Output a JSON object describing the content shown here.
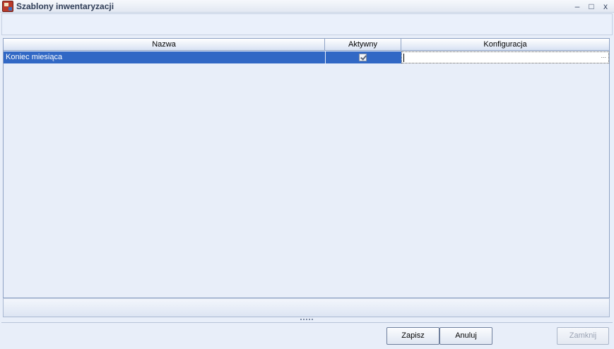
{
  "window": {
    "title": "Szablony inwentaryzacji",
    "minimize_glyph": "–",
    "maximize_glyph": "□",
    "close_glyph": "x"
  },
  "grid": {
    "columns": [
      "Nazwa",
      "Aktywny",
      "Konfiguracja"
    ],
    "rows": [
      {
        "name": "Koniec miesiąca",
        "active": true,
        "config": "",
        "config_button": "..."
      }
    ],
    "selection_color": "#3168c5"
  },
  "buttons": {
    "save": "Zapisz",
    "cancel": "Anuluj",
    "close": "Zamknij"
  },
  "icons": {
    "app": "app-icon",
    "checkbox": "checkbox-checked-icon"
  }
}
